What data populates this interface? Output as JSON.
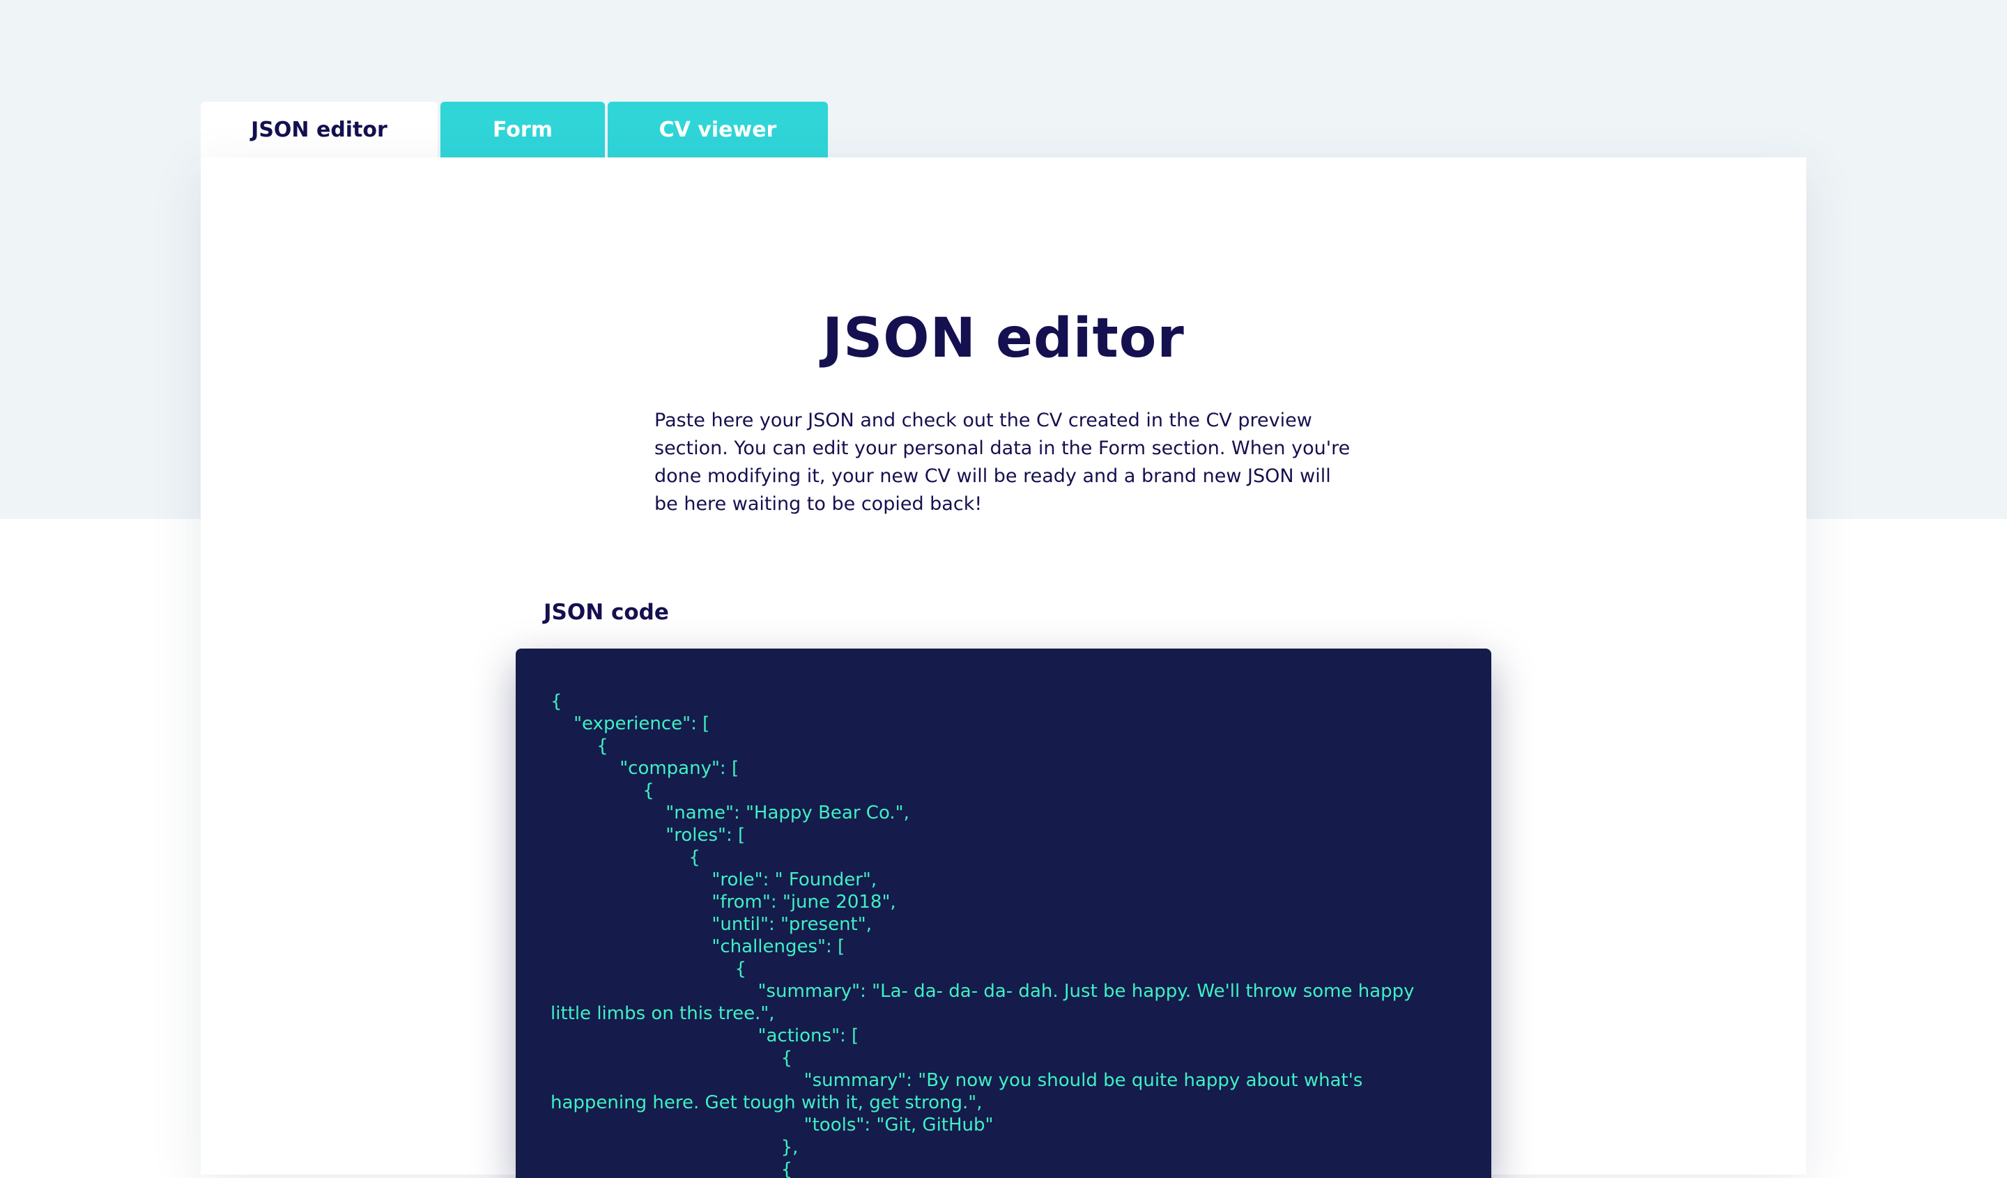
{
  "tabs": [
    {
      "label": "JSON editor",
      "active": true
    },
    {
      "label": "Form",
      "active": false
    },
    {
      "label": "CV viewer",
      "active": false
    }
  ],
  "main": {
    "title": "JSON editor",
    "description": "Paste here your JSON and check out the CV created in the CV preview section. You can edit your personal data in the Form section. When you're done modifying it, your new CV will be ready and a brand new JSON will be here waiting to be copied back!",
    "code_label": "JSON code",
    "code": "{\n    \"experience\": [\n        {\n            \"company\": [\n                {\n                    \"name\": \"Happy Bear Co.\",\n                    \"roles\": [\n                        {\n                            \"role\": \" Founder\",\n                            \"from\": \"june 2018\",\n                            \"until\": \"present\",\n                            \"challenges\": [\n                                {\n                                    \"summary\": \"La- da- da- da- dah. Just be happy. We'll throw some happy little limbs on this tree.\",\n                                    \"actions\": [\n                                        {\n                                            \"summary\": \"By now you should be quite happy about what's happening here. Get tough with it, get strong.\",\n                                            \"tools\": \"Git, GitHub\"\n                                        },\n                                        {"
  },
  "colors": {
    "navy": "#15104f",
    "teal": "#30d5d8",
    "code_bg": "#151b4b",
    "code_text": "#3ff0c3",
    "page_bg": "#eff4f7"
  }
}
